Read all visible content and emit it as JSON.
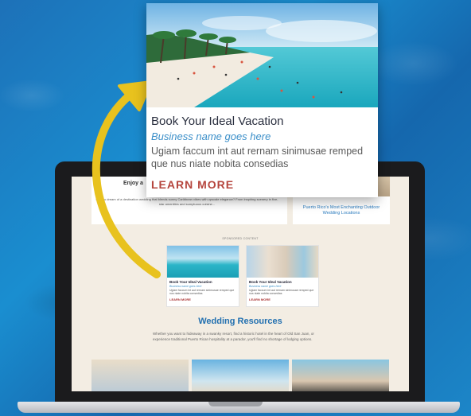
{
  "ad": {
    "title": "Book Your Ideal Vacation",
    "subtitle": "Business name goes here",
    "body": "Ugiam faccum int aut rernam sinimusae remped que nus niate nobita consedias",
    "link": "LEARN MORE"
  },
  "screen": {
    "enjoy_heading": "Enjoy a",
    "dream_text": "Do you dream of a destination wedding that blends sunny Caribbean vibes with upscale elegance? From inspiring scenery in five-star amenities and sumptuous cuisine...",
    "right_card_title": "Puerto Rico's Most Enchanting Outdoor Wedding Locations",
    "sponsored_label": "SPONSORED CONTENT",
    "mini_ads": [
      {
        "title": "Book Your Ideal Vacation",
        "subtitle": "Business name goes here",
        "body": "Ugiam faccum int aut rernam sinimusae remped que nus niate nobita consedias",
        "link": "LEARN MORE"
      },
      {
        "title": "Book Your Ideal Vacation",
        "subtitle": "Business name goes here",
        "body": "Ugiam faccum int aut rernam sinimusae remped que nus niate nobita consedias",
        "link": "LEARN MORE"
      }
    ],
    "wedding_heading": "Wedding Resources",
    "wedding_text": "Whether you want to hideaway in a swanky resort, find a historic hotel in the heart of Old San Juan, or experience traditional Puerto Rican hospitality at a parador, you'll find no shortage of lodging options."
  },
  "colors": {
    "background": "#1a7fc4",
    "arrow": "#e8c21e",
    "link": "#b5453d",
    "accent": "#2270b0"
  }
}
